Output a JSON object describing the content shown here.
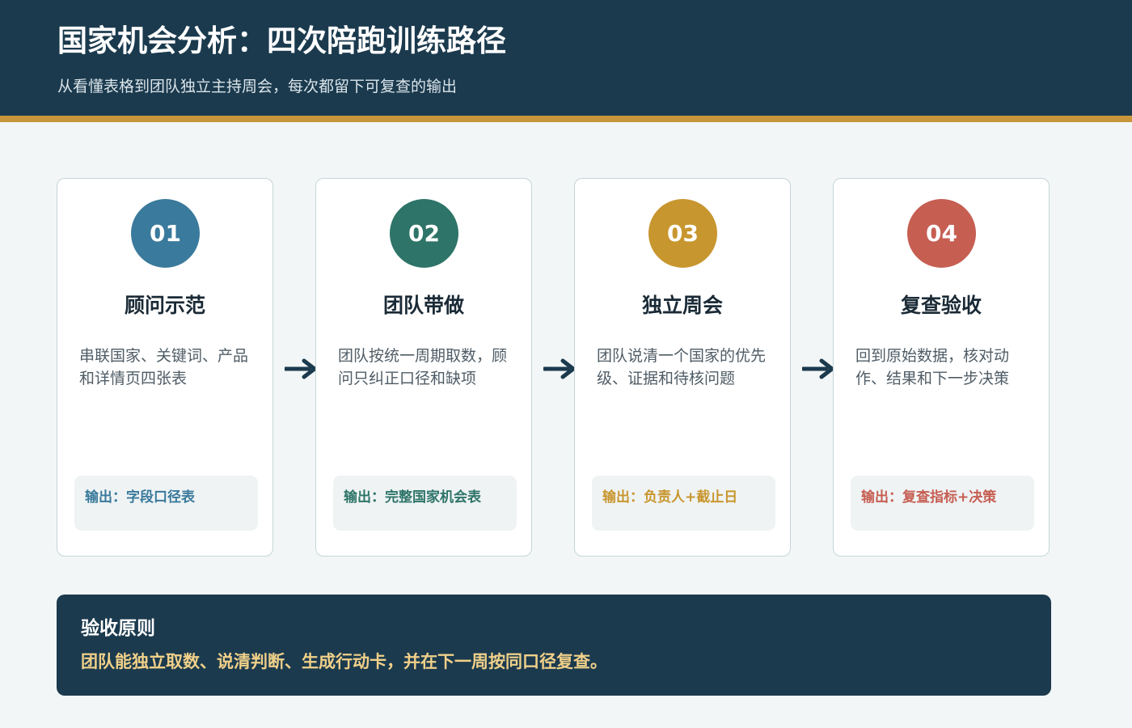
{
  "header": {
    "title": "国家机会分析：四次陪跑训练路径",
    "subtitle": "从看懂表格到团队独立主持周会，每次都留下可复查的输出"
  },
  "steps": [
    {
      "number": "01",
      "title": "顾问示范",
      "description": "串联国家、关键词、产品和详情页四张表",
      "output": "输出：字段口径表",
      "color": "#3a7a9c"
    },
    {
      "number": "02",
      "title": "团队带做",
      "description": "团队按统一周期取数，顾问只纠正口径和缺项",
      "output": "输出：完整国家机会表",
      "color": "#2e7468"
    },
    {
      "number": "03",
      "title": "独立周会",
      "description": "团队说清一个国家的优先级、证据和待核问题",
      "output": "输出：负责人+截止日",
      "color": "#c8962f"
    },
    {
      "number": "04",
      "title": "复查验收",
      "description": "回到原始数据，核对动作、结果和下一步决策",
      "output": "输出：复查指标+决策",
      "color": "#c65e52"
    }
  ],
  "principle": {
    "title": "验收原则",
    "text": "团队能独立取数、说清判断、生成行动卡，并在下一周按同口径复查。"
  },
  "colors": {
    "header_bg": "#1b3a4e",
    "accent_stripe": "#c8963a",
    "arrow": "#1b3a4e"
  },
  "icons": {
    "connector": "arrow-right-icon"
  }
}
